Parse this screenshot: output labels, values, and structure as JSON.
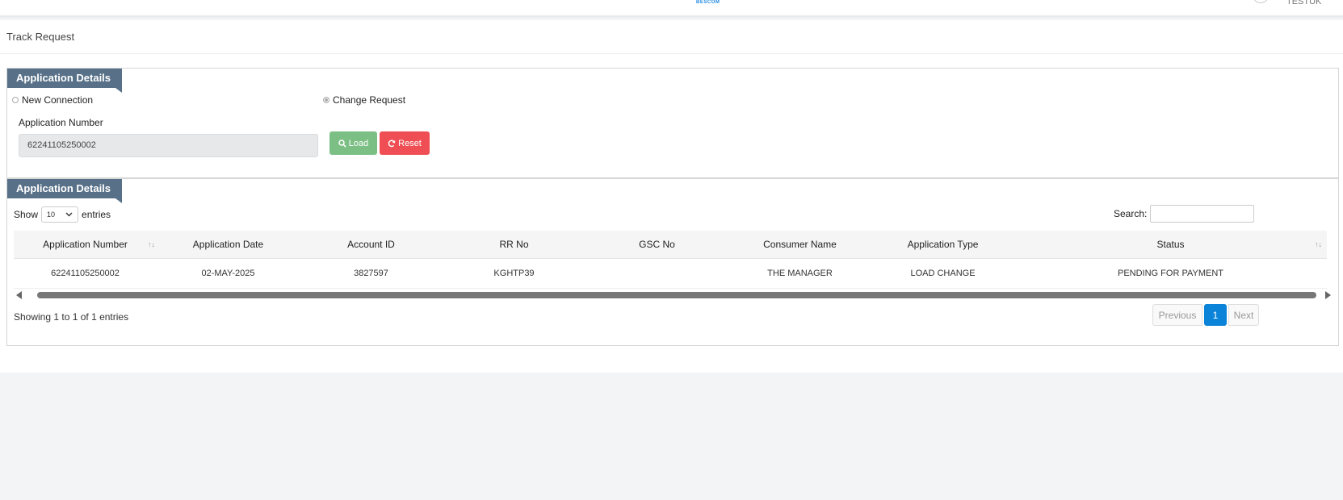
{
  "header": {
    "brand": "BESCOM",
    "user_name": "TESTUK"
  },
  "page": {
    "title": "Track Request"
  },
  "form_panel": {
    "title": "Application Details",
    "radios": [
      {
        "label": "New Connection",
        "checked": false
      },
      {
        "label": "Change Request",
        "checked": true
      }
    ],
    "app_number_label": "Application Number",
    "app_number_value": "62241105250002",
    "load_label": "Load",
    "reset_label": "Reset"
  },
  "results_panel": {
    "title": "Application Details",
    "show_label": "Show",
    "page_size": "10",
    "entries_label": "entries",
    "search_label": "Search:",
    "search_value": "",
    "columns": [
      "Application Number",
      "Application Date",
      "Account ID",
      "RR No",
      "GSC No",
      "Consumer Name",
      "Application Type",
      "Status"
    ],
    "rows": [
      [
        "62241105250002",
        "02-MAY-2025",
        "3827597",
        "KGHTP39",
        "",
        "THE MANAGER",
        "LOAD CHANGE",
        "PENDING FOR PAYMENT"
      ]
    ],
    "info": "Showing 1 to 1 of 1 entries",
    "pagination": {
      "previous": "Previous",
      "current": "1",
      "next": "Next"
    }
  },
  "colors": {
    "panel_header": "#587188",
    "load": "#7cbf85",
    "reset": "#ef4f54",
    "active_page": "#0b83d8"
  },
  "icons": {
    "load": "search-icon",
    "reset": "refresh-icon",
    "select": "chevron-down-icon",
    "sort": "sort-icon"
  }
}
